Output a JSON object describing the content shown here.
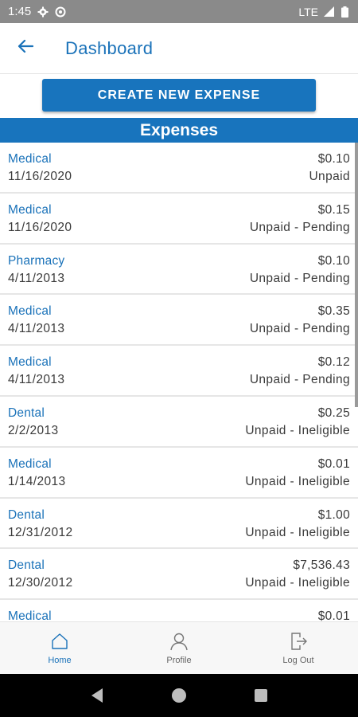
{
  "status_bar": {
    "time": "1:45",
    "network": "LTE",
    "icons": [
      "settings-icon",
      "sync-icon",
      "signal-icon",
      "battery-icon"
    ]
  },
  "app_bar": {
    "back_icon": "arrow-left-icon",
    "title": "Dashboard"
  },
  "actions": {
    "create_label": "CREATE NEW EXPENSE"
  },
  "expenses": {
    "header": "Expenses",
    "items": [
      {
        "category": "Medical",
        "date": "11/16/2020",
        "amount": "$0.10",
        "status": "Unpaid"
      },
      {
        "category": "Medical",
        "date": "11/16/2020",
        "amount": "$0.15",
        "status": "Unpaid - Pending"
      },
      {
        "category": "Pharmacy",
        "date": "4/11/2013",
        "amount": "$0.10",
        "status": "Unpaid - Pending"
      },
      {
        "category": "Medical",
        "date": "4/11/2013",
        "amount": "$0.35",
        "status": "Unpaid - Pending"
      },
      {
        "category": "Medical",
        "date": "4/11/2013",
        "amount": "$0.12",
        "status": "Unpaid - Pending"
      },
      {
        "category": "Dental",
        "date": "2/2/2013",
        "amount": "$0.25",
        "status": "Unpaid - Ineligible"
      },
      {
        "category": "Medical",
        "date": "1/14/2013",
        "amount": "$0.01",
        "status": "Unpaid - Ineligible"
      },
      {
        "category": "Dental",
        "date": "12/31/2012",
        "amount": "$1.00",
        "status": "Unpaid - Ineligible"
      },
      {
        "category": "Dental",
        "date": "12/30/2012",
        "amount": "$7,536.43",
        "status": "Unpaid - Ineligible"
      },
      {
        "category": "Medical",
        "date": "",
        "amount": "$0.01",
        "status": ""
      }
    ]
  },
  "bottom_nav": {
    "items": [
      {
        "label": "Home",
        "icon": "home-icon",
        "active": true
      },
      {
        "label": "Profile",
        "icon": "profile-icon",
        "active": false
      },
      {
        "label": "Log Out",
        "icon": "logout-icon",
        "active": false
      }
    ]
  },
  "system_nav": {
    "icons": [
      "back-triangle-icon",
      "home-circle-icon",
      "recents-square-icon"
    ]
  },
  "colors": {
    "accent": "#1874bd",
    "link": "#1a72b9",
    "status_bar": "#8a8a8a"
  }
}
